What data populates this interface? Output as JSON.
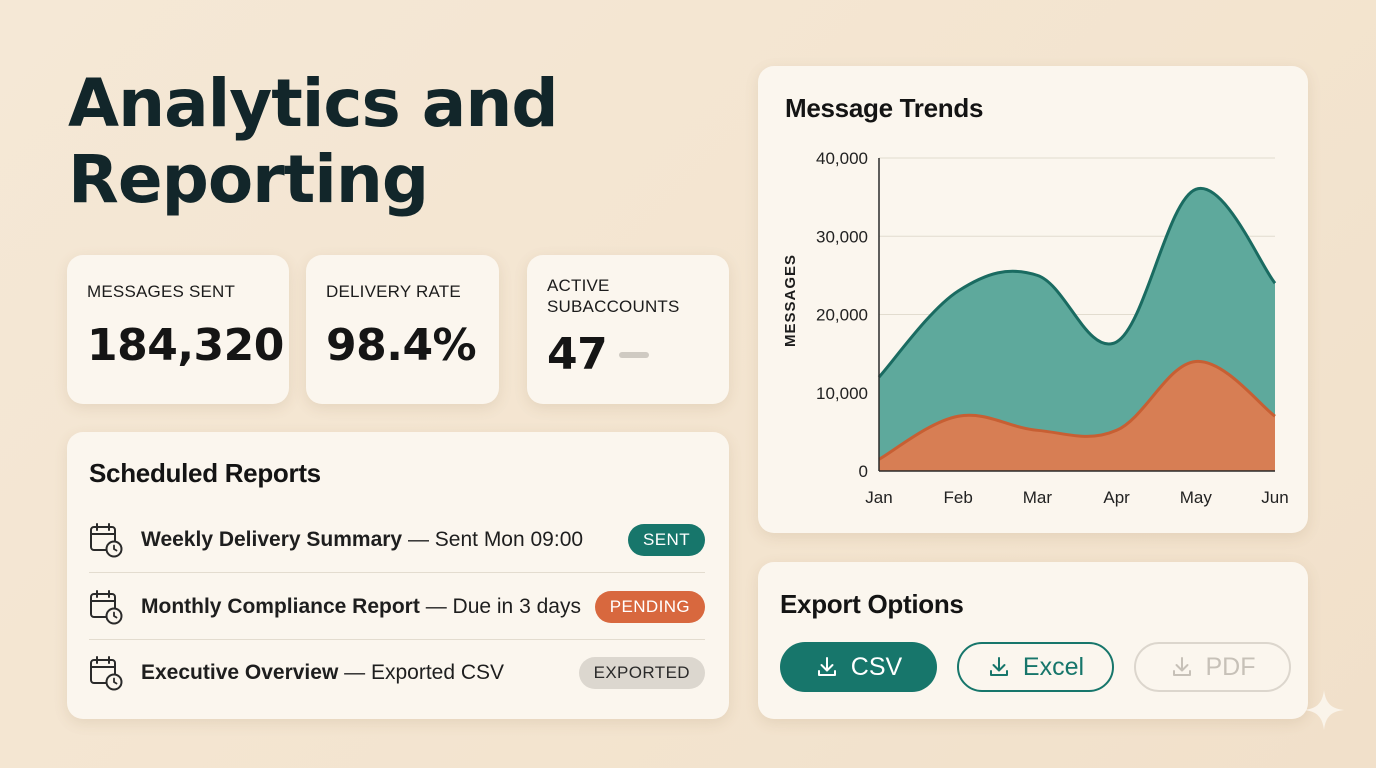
{
  "page": {
    "title_line1": "Analytics and",
    "title_line2": "Reporting"
  },
  "metrics": [
    {
      "label": "MESSAGES SENT",
      "value": "184,320",
      "trend": "up"
    },
    {
      "label": "DELIVERY RATE",
      "value": "98.4%",
      "trend": "up"
    },
    {
      "label_line1": "ACTIVE",
      "label_line2": "SUBACCOUNTS",
      "value": "47",
      "trend": "flat"
    }
  ],
  "reports": {
    "title": "Scheduled Reports",
    "items": [
      {
        "name": "Weekly Delivery Summary",
        "detail": " — Sent Mon 09:00",
        "status": "SENT"
      },
      {
        "name": "Monthly Compliance Report",
        "detail": " — Due in 3 days",
        "status": "PENDING"
      },
      {
        "name": "Executive Overview",
        "detail": " — Exported CSV",
        "status": "EXPORTED"
      }
    ]
  },
  "export": {
    "title": "Export Options",
    "csv_label": "CSV",
    "excel_label": "Excel",
    "pdf_label": "PDF"
  },
  "colors": {
    "accent": "#17766b",
    "teal_area": "#5ea99c",
    "orange_area": "#d77e54",
    "pending": "#d8683e"
  },
  "icons": [
    "trend-up-icon",
    "trend-flat-icon",
    "calendar-clock-icon",
    "download-icon",
    "sparkle-icon"
  ],
  "chart_data": {
    "type": "area",
    "title": "Message Trends",
    "ylabel": "MESSAGES",
    "xlabel": "",
    "categories": [
      "Jan",
      "Feb",
      "Mar",
      "Apr",
      "May",
      "Jun"
    ],
    "ylim": [
      0,
      40000
    ],
    "yticks": [
      "0",
      "10,000",
      "20,000",
      "30,000",
      "40,000"
    ],
    "grid": true,
    "series": [
      {
        "color": "#5ea99c",
        "stroke": "#1a6b61",
        "values": [
          12000,
          23000,
          25000,
          16500,
          36000,
          24000
        ]
      },
      {
        "color": "#d77e54",
        "stroke": "#c75f33",
        "values": [
          1500,
          7000,
          5200,
          5200,
          14000,
          7000
        ]
      }
    ]
  }
}
